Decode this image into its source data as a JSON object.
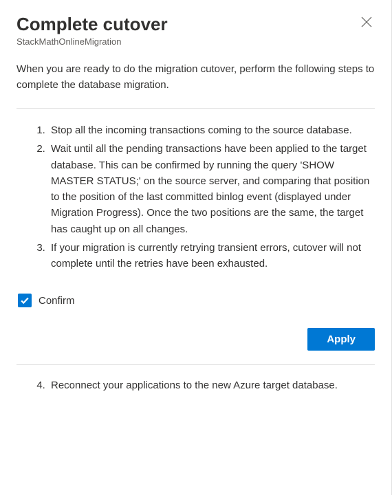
{
  "header": {
    "title": "Complete cutover",
    "subtitle": "StackMathOnlineMigration"
  },
  "intro": "When you are ready to do the migration cutover, perform the following steps to complete the database migration.",
  "steps_part1": [
    "Stop all the incoming transactions coming to the source database.",
    "Wait until all the pending transactions have been applied to the target database. This can be confirmed by running the query 'SHOW MASTER STATUS;' on the source server, and comparing that position to the position of the last committed binlog event (displayed under Migration Progress). Once the two positions are the same, the target has caught up on all changes.",
    "If your migration is currently retrying transient errors, cutover will not complete until the retries have been exhausted."
  ],
  "confirm": {
    "label": "Confirm",
    "checked": true
  },
  "buttons": {
    "apply": "Apply"
  },
  "steps_part2": [
    "Reconnect your applications to the new Azure target database."
  ]
}
